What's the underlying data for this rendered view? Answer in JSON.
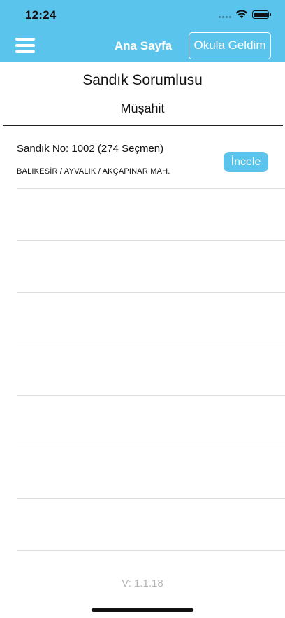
{
  "status_bar": {
    "time": "12:24"
  },
  "nav": {
    "title": "Ana Sayfa",
    "action_button": "Okula Geldim",
    "menu_icon": "hamburger-menu-icon",
    "accent_color": "#5bc4ec"
  },
  "heading": {
    "title": "Sandık Sorumlusu",
    "subtitle": "Müşahit"
  },
  "ballot_list": [
    {
      "title": "Sandık No: 1002 (274 Seçmen)",
      "location": "BALIKESİR / AYVALIK / AKÇAPINAR MAH.",
      "button_label": "İncele"
    }
  ],
  "footer": {
    "version": "V: 1.1.18"
  }
}
